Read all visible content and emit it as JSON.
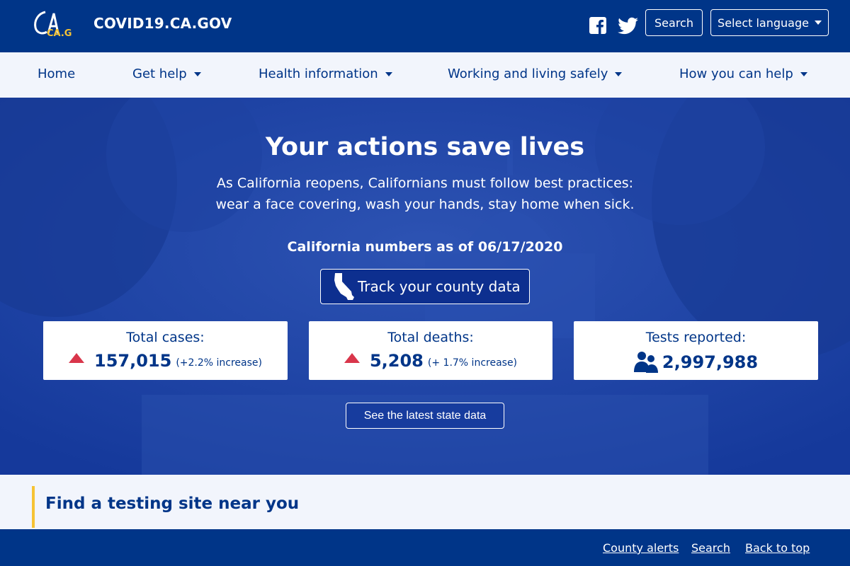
{
  "header": {
    "site_title": "COVID19.CA.GOV",
    "logo_text": "CA.GOV",
    "search_label": "Search",
    "language_label": "Select language"
  },
  "nav": {
    "items": [
      {
        "label": "Home",
        "has_dropdown": false
      },
      {
        "label": "Get help",
        "has_dropdown": true
      },
      {
        "label": "Health information",
        "has_dropdown": true
      },
      {
        "label": "Working and living safely",
        "has_dropdown": true
      },
      {
        "label": "How you can help",
        "has_dropdown": true
      }
    ]
  },
  "hero": {
    "title": "Your actions save lives",
    "subtitle_line1": "As California reopens, Californians must follow best practices:",
    "subtitle_line2": "wear a face covering, wash your hands, stay home when sick.",
    "numbers_date": "California numbers as of 06/17/2020",
    "track_label": "Track your county data",
    "latest_label": "See the latest state data"
  },
  "stats": {
    "cases": {
      "label": "Total cases:",
      "value": "157,015",
      "change": "(+2.2% increase)"
    },
    "deaths": {
      "label": "Total deaths:",
      "value": "5,208",
      "change": "(+ 1.7% increase)"
    },
    "tests": {
      "label": "Tests reported:",
      "value": "2,997,988"
    }
  },
  "testing": {
    "title": "Find a testing site near you"
  },
  "footer": {
    "county_alerts": "County alerts",
    "search": "Search",
    "back_to_top": "Back to top"
  },
  "colors": {
    "brand_blue": "#003588",
    "hero_blue": "#1c43a6",
    "accent_yellow": "#f6c334",
    "alert_red": "#d9364b"
  }
}
